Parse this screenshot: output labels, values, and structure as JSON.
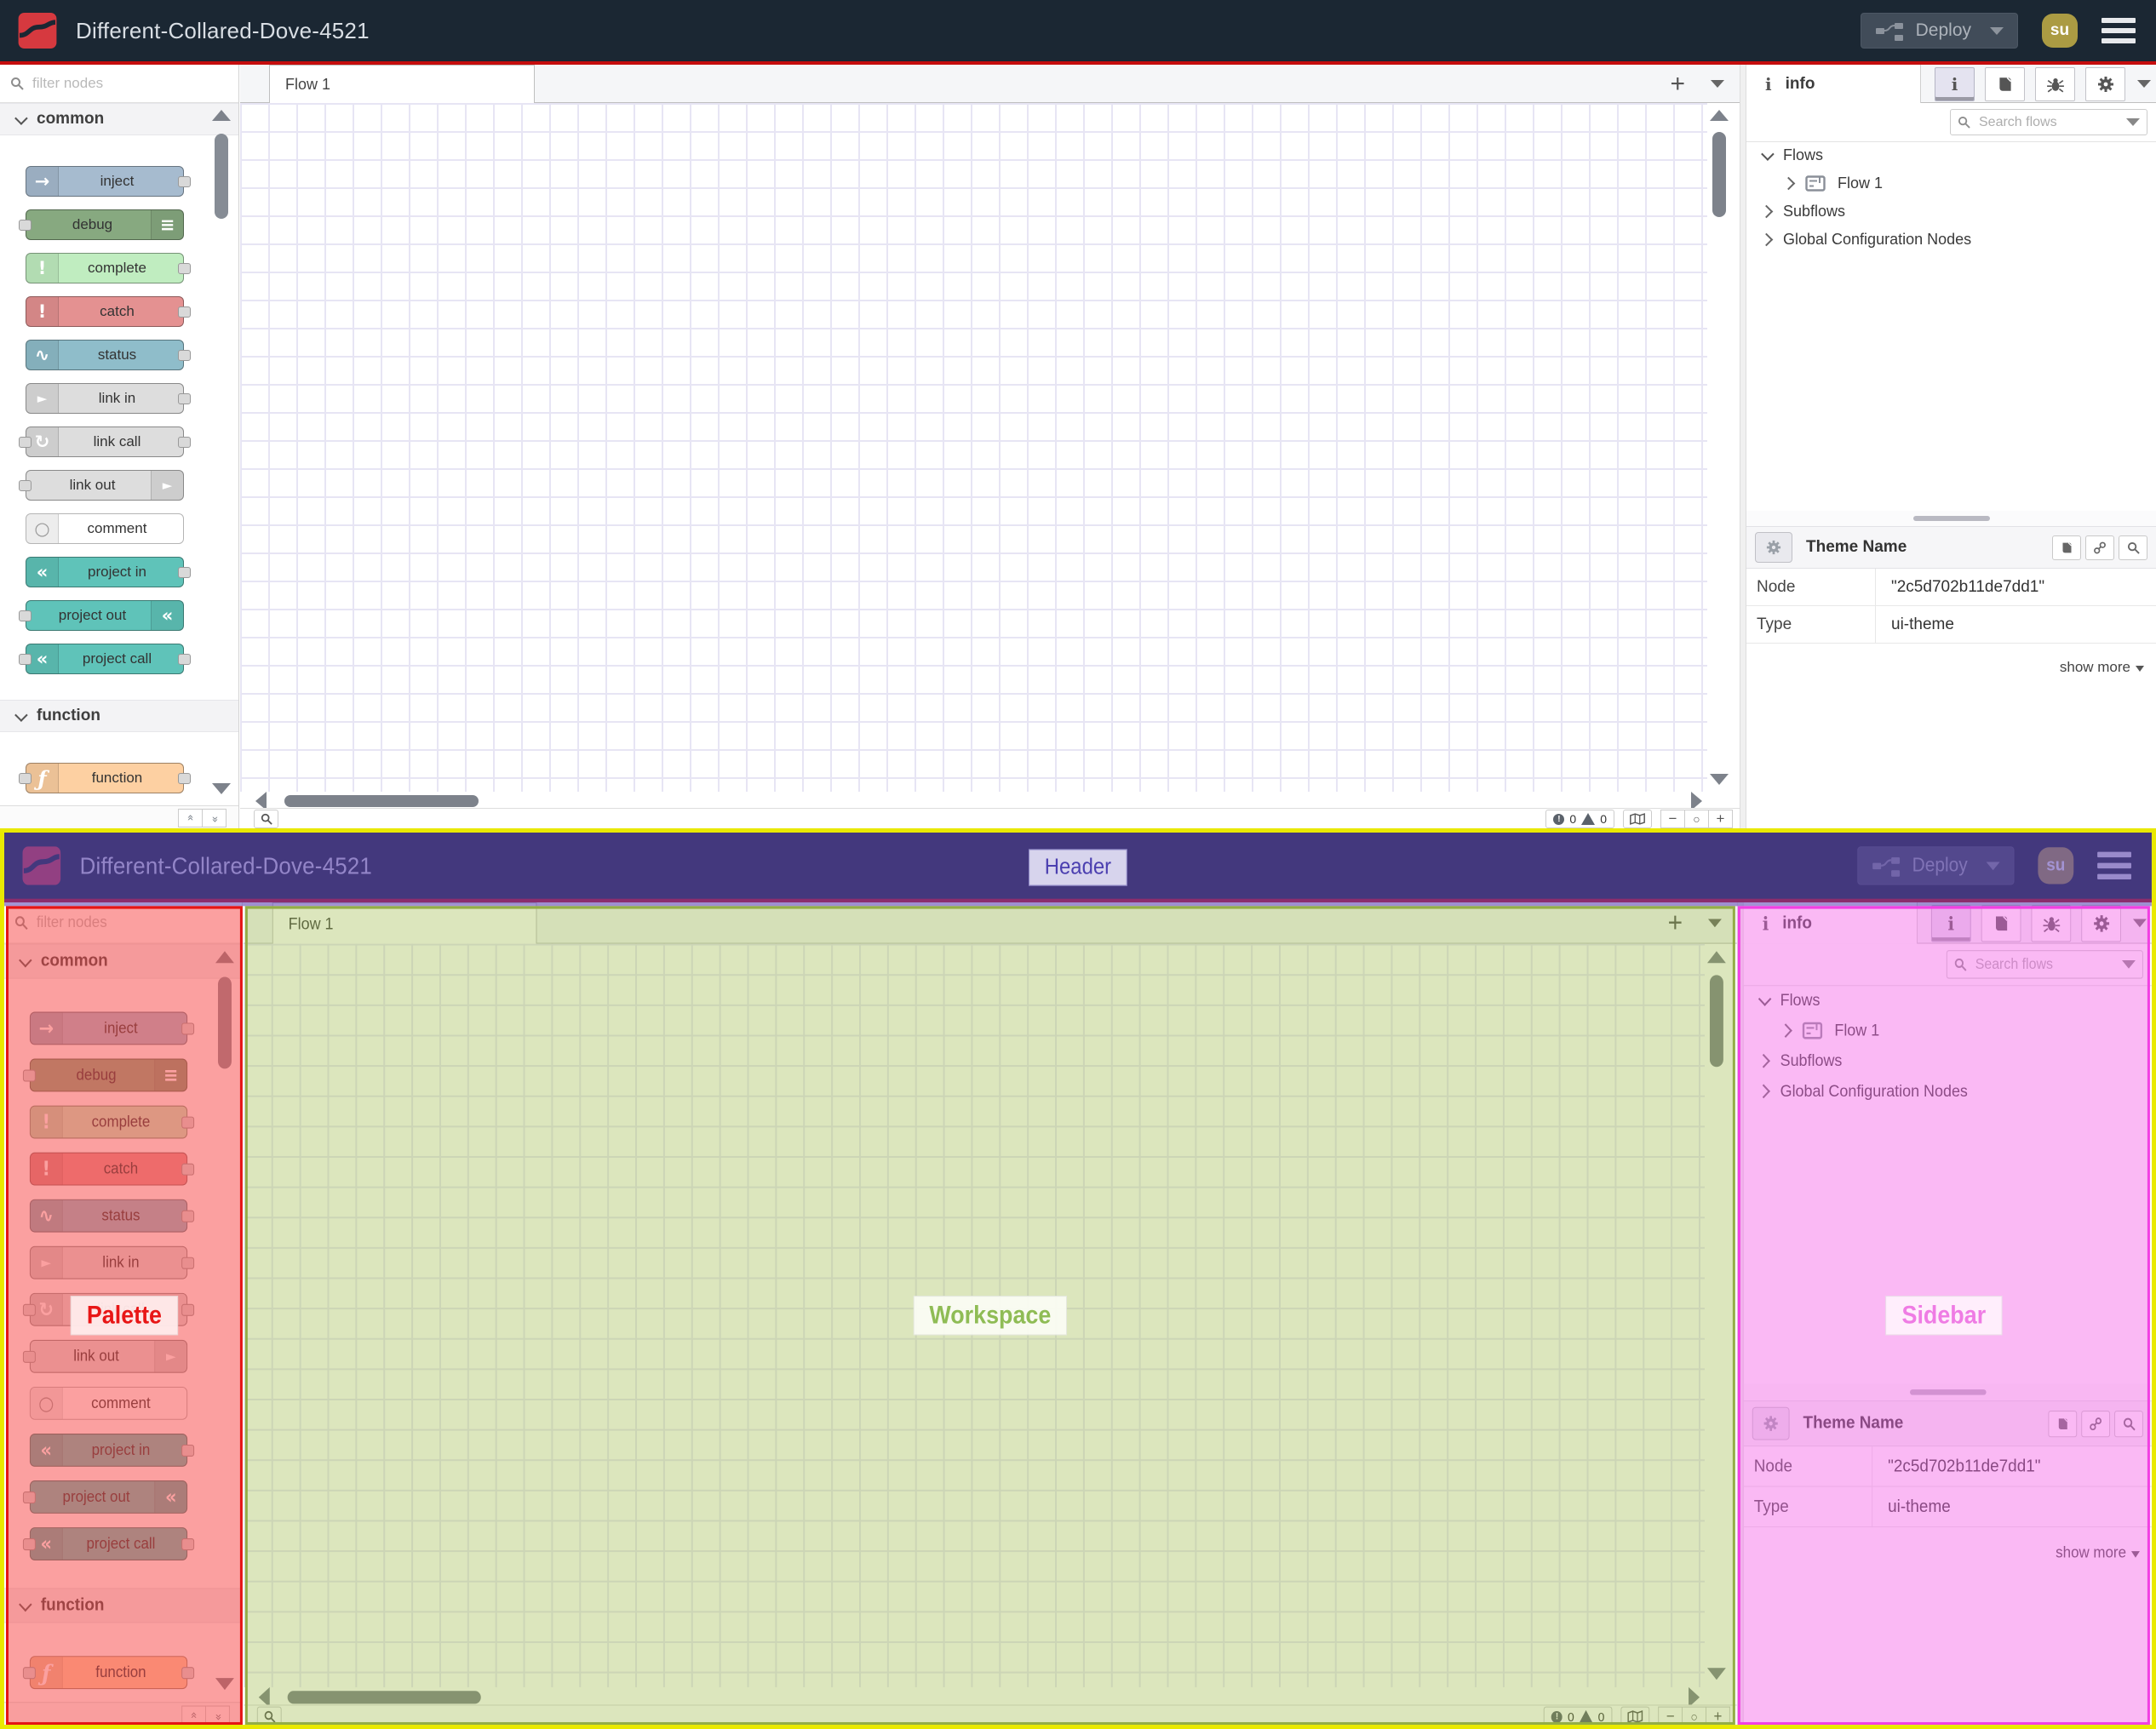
{
  "header": {
    "title": "Different-Collared-Dove-4521",
    "deploy_label": "Deploy",
    "avatar_text": "su"
  },
  "palette": {
    "filter_placeholder": "filter nodes",
    "categories": [
      {
        "label": "common",
        "nodes": [
          {
            "label": "inject",
            "color": "#a6bbcf",
            "icon": "inject-icon",
            "icon_side": "left",
            "ports": "right"
          },
          {
            "label": "debug",
            "color": "#87a980",
            "icon": "debug-icon",
            "icon_side": "right",
            "ports": "left"
          },
          {
            "label": "complete",
            "color": "#c0edc0",
            "icon": "exclamation-icon",
            "icon_side": "left",
            "ports": "right"
          },
          {
            "label": "catch",
            "color": "#e49191",
            "icon": "exclamation-icon",
            "icon_side": "left",
            "ports": "right"
          },
          {
            "label": "status",
            "color": "#8fbdca",
            "icon": "status-pulse-icon",
            "icon_side": "left",
            "ports": "right"
          },
          {
            "label": "link in",
            "color": "#dddddd",
            "icon": "link-in-icon",
            "icon_side": "left",
            "ports": "right"
          },
          {
            "label": "link call",
            "color": "#dddddd",
            "icon": "link-call-icon",
            "icon_side": "left",
            "ports": "both"
          },
          {
            "label": "link out",
            "color": "#dddddd",
            "icon": "link-out-icon",
            "icon_side": "right",
            "ports": "left"
          },
          {
            "label": "comment",
            "color": "#ffffff",
            "icon": "comment-bubble-icon",
            "icon_side": "left",
            "ports": "none",
            "icon_color": "#9a9a9a",
            "border": "#b5b5b5"
          },
          {
            "label": "project in",
            "color": "#5fc3b9",
            "icon": "node-red-icon",
            "icon_side": "left",
            "ports": "right"
          },
          {
            "label": "project out",
            "color": "#5fc3b9",
            "icon": "node-red-icon",
            "icon_side": "right",
            "ports": "left"
          },
          {
            "label": "project call",
            "color": "#5fc3b9",
            "icon": "node-red-icon",
            "icon_side": "left",
            "ports": "both"
          }
        ]
      },
      {
        "label": "function",
        "nodes": [
          {
            "label": "function",
            "color": "#fdd0a2",
            "icon": "function-icon",
            "icon_side": "left",
            "ports": "both"
          }
        ]
      }
    ]
  },
  "workspace": {
    "tab_label": "Flow 1",
    "error_count": "0",
    "warning_count": "0"
  },
  "sidebar": {
    "tab_label": "info",
    "search_placeholder": "Search flows",
    "tree": {
      "flows_label": "Flows",
      "flow1_label": "Flow 1",
      "subflows_label": "Subflows",
      "global_label": "Global Configuration Nodes"
    },
    "panel": {
      "title": "Theme Name",
      "node_key": "Node",
      "node_value": "\"2c5d702b11de7dd1\"",
      "type_key": "Type",
      "type_value": "ui-theme",
      "show_more": "show more"
    }
  },
  "annotations": {
    "header": "Header",
    "palette": "Palette",
    "workspace": "Workspace",
    "sidebar": "Sidebar"
  },
  "colors": {
    "header_bg": "#1b2733",
    "header_accent_line": "#c50d0d",
    "logo_red": "#d6393f",
    "node_string_red": "#ad1625",
    "annotation_header": "#6045b4",
    "annotation_palette": "#e51414",
    "annotation_workspace": "#93ad46",
    "annotation_sidebar": "#f23fe3",
    "annotation_outer_border": "#e9e900"
  }
}
